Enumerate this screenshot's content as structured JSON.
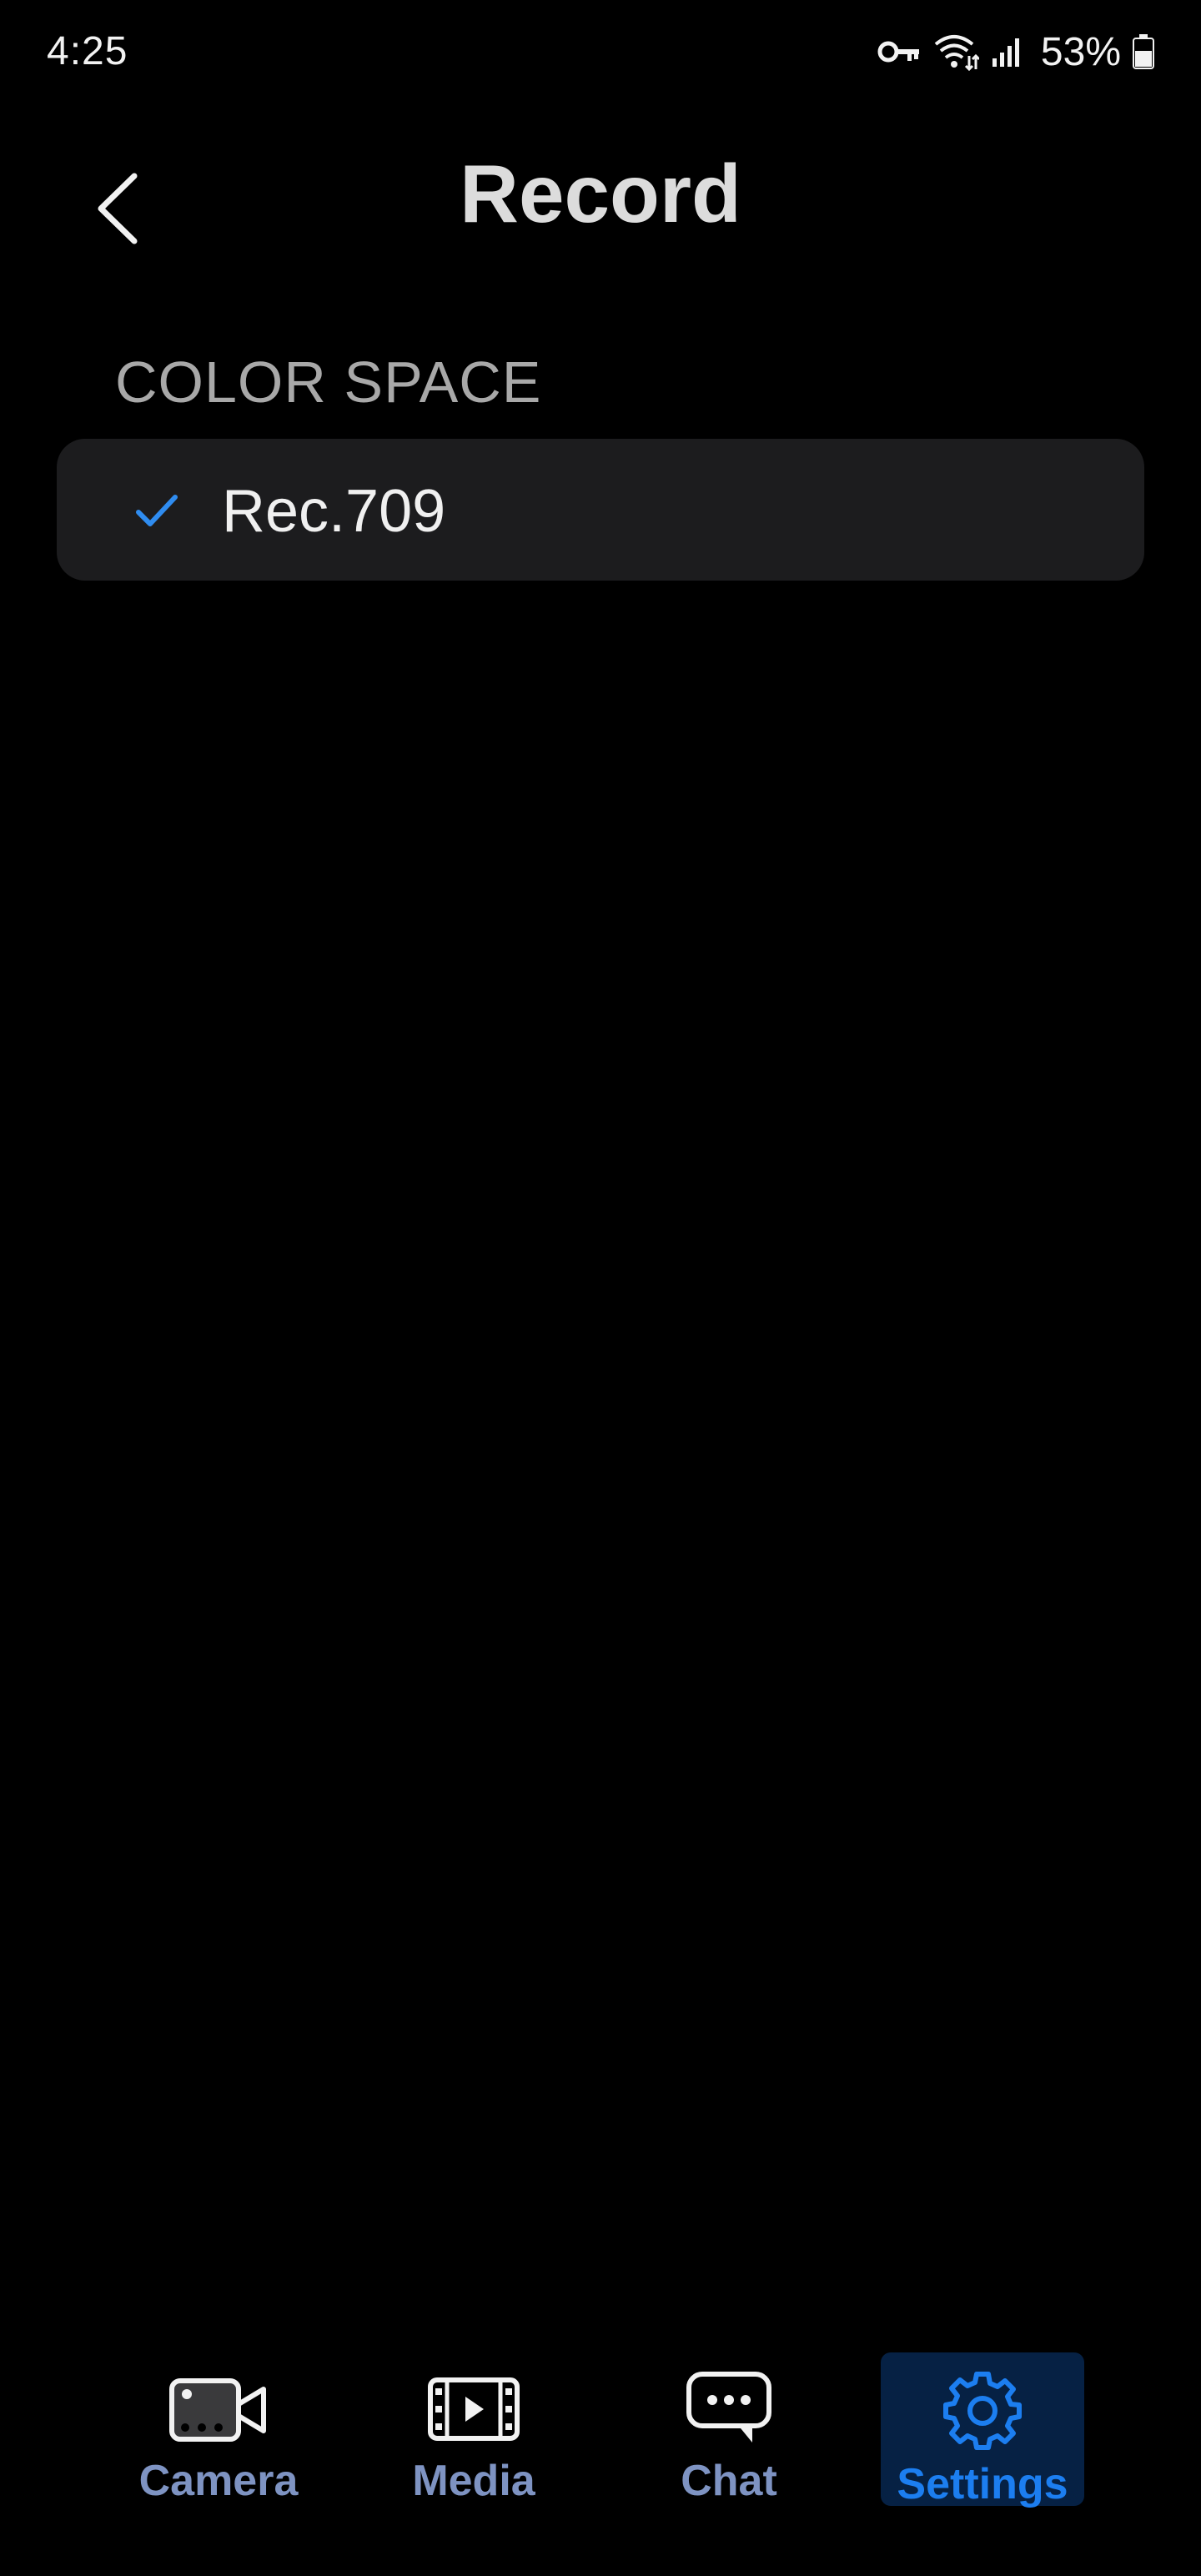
{
  "status_bar": {
    "time": "4:25",
    "battery_percent": "53%",
    "icons": [
      "vpn-key-icon",
      "wifi-icon",
      "signal-icon",
      "battery-icon"
    ]
  },
  "header": {
    "title": "Record",
    "back_icon": "chevron-left-icon"
  },
  "section": {
    "label": "COLOR SPACE",
    "options": [
      {
        "label": "Rec.709",
        "selected": true,
        "icon": "check-icon"
      }
    ]
  },
  "bottom_nav": {
    "items": [
      {
        "label": "Camera",
        "icon": "video-camera-icon",
        "active": false
      },
      {
        "label": "Media",
        "icon": "film-play-icon",
        "active": false
      },
      {
        "label": "Chat",
        "icon": "chat-bubble-icon",
        "active": false
      },
      {
        "label": "Settings",
        "icon": "gear-icon",
        "active": true
      }
    ]
  },
  "colors": {
    "background": "#000000",
    "card": "#1c1c1e",
    "accent": "#1c7ef0",
    "check": "#2f8cf0",
    "nav_inactive": "#7e93c2",
    "nav_active_bg": "#062144"
  }
}
